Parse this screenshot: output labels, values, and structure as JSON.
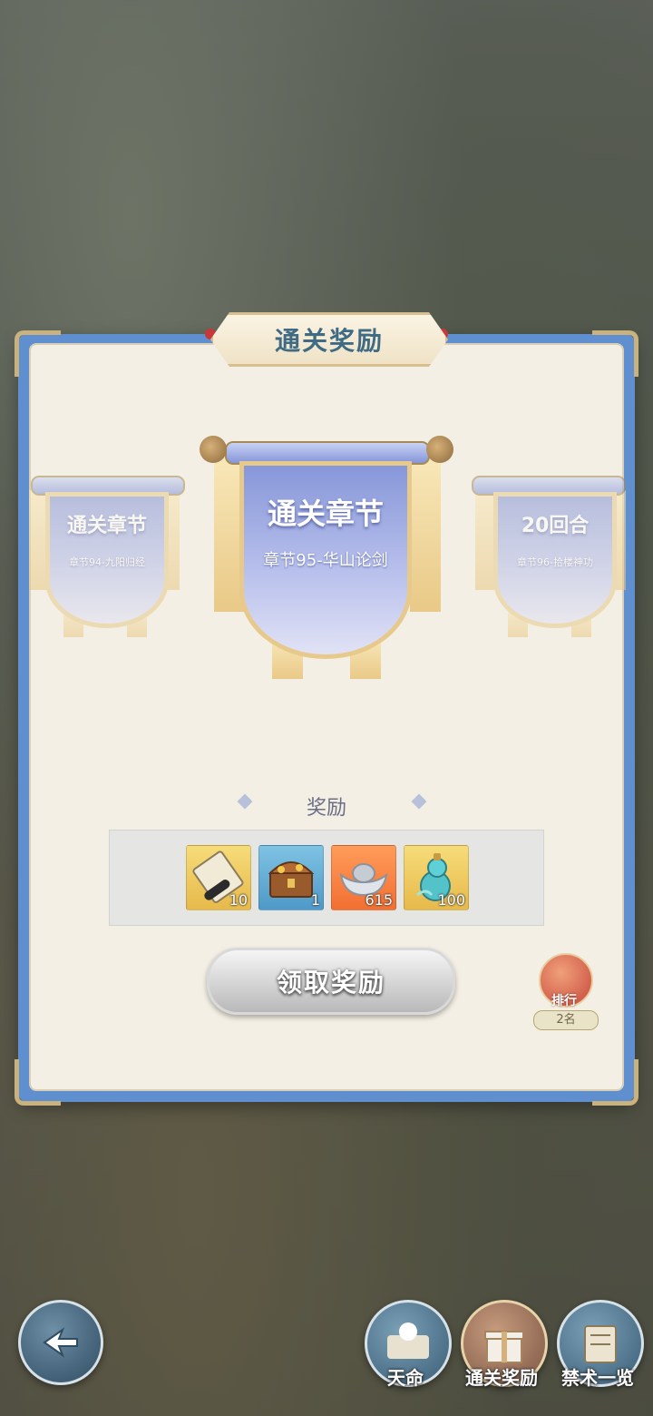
{
  "title": "通关奖励",
  "banners": {
    "left": {
      "title": "通关章节",
      "subtitle": "章节94-九阳归经"
    },
    "center": {
      "title": "通关章节",
      "subtitle": "章节95-华山论剑"
    },
    "right": {
      "title": "20回合",
      "subtitle": "章节96-拾楼神功"
    }
  },
  "rewards": {
    "header": "奖励",
    "items": [
      {
        "icon": "scroll-icon",
        "count": "10"
      },
      {
        "icon": "treasure-chest-icon",
        "count": "1"
      },
      {
        "icon": "silver-ingot-icon",
        "count": "615"
      },
      {
        "icon": "gourd-icon",
        "count": "100"
      }
    ]
  },
  "claim_button": "领取奖励",
  "rank": {
    "label": "排行",
    "value": "2名"
  },
  "nav": {
    "fate": "天命",
    "clear_rewards": "通关奖励",
    "forbidden_list": "禁术一览"
  },
  "colors": {
    "panel_blue": "#5f8fcf",
    "title_text": "#3f6b84",
    "cloth": "#8797d8"
  }
}
